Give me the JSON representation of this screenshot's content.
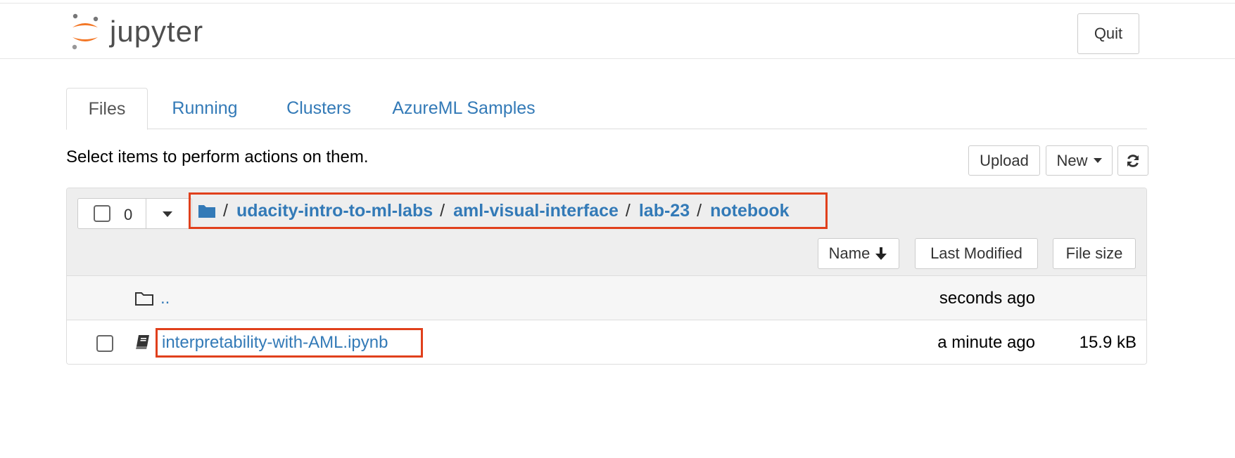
{
  "header": {
    "logo_text": "jupyter",
    "quit_label": "Quit"
  },
  "tabs": [
    {
      "label": "Files",
      "active": true
    },
    {
      "label": "Running",
      "active": false
    },
    {
      "label": "Clusters",
      "active": false
    },
    {
      "label": "AzureML Samples",
      "active": false
    }
  ],
  "toolbar": {
    "hint": "Select items to perform actions on them.",
    "upload_label": "Upload",
    "new_label": "New"
  },
  "selector": {
    "count": "0"
  },
  "breadcrumb": {
    "root_sep": "/",
    "items": [
      {
        "label": "udacity-intro-to-ml-labs"
      },
      {
        "label": "aml-visual-interface"
      },
      {
        "label": "lab-23"
      },
      {
        "label": "notebook"
      }
    ]
  },
  "columns": {
    "name": "Name",
    "last_modified": "Last Modified",
    "file_size": "File size"
  },
  "rows": [
    {
      "name": "..",
      "type": "folder",
      "modified": "seconds ago",
      "size": ""
    },
    {
      "name": "interpretability-with-AML.ipynb",
      "type": "notebook",
      "modified": "a minute ago",
      "size": "15.9 kB"
    }
  ],
  "colors": {
    "link": "#337ab7",
    "highlight": "#e0401c",
    "logo_orange": "#f37726"
  }
}
